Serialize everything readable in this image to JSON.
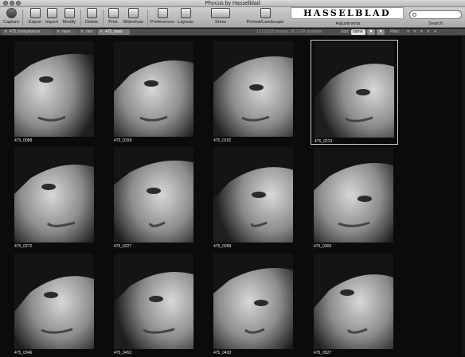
{
  "window": {
    "title": "Phocus by Hasselblad"
  },
  "toolbar": {
    "capture": "Capture",
    "export": "Export",
    "import": "Import",
    "modify": "Modify",
    "delete": "Delete",
    "print": "Print",
    "slideshow": "Slideshow",
    "preferences": "Preferences",
    "layouts": "Layouts",
    "show": "Show",
    "portrait_landscape": "Portrait/Landscape",
    "brand": "HASSELBLAD",
    "adjustments": "Adjustments",
    "search_label": "Search",
    "search_value": ""
  },
  "tabs": [
    {
      "label": "475_kompetanse"
    },
    {
      "label": "raws"
    },
    {
      "label": "raw"
    },
    {
      "label": "475_raws"
    }
  ],
  "statusbar": {
    "info": "12 (13/28) images, 85.1 GB available",
    "sort_label": "Sort:",
    "sort_value": "name",
    "filter_label": "Filter:",
    "filter_stars": "★ ★ ★ ★ ★"
  },
  "thumbnails": [
    {
      "name": "475_0088"
    },
    {
      "name": "475_0158"
    },
    {
      "name": "475_0192"
    },
    {
      "name": "475_0219"
    },
    {
      "name": "475_0272"
    },
    {
      "name": "475_0227"
    },
    {
      "name": "475_0288"
    },
    {
      "name": "475_0306"
    },
    {
      "name": "475_0346"
    },
    {
      "name": "475_0452"
    },
    {
      "name": "475_0493"
    },
    {
      "name": "475_0527"
    }
  ],
  "selected_index": 3,
  "colors": {
    "background": "#0b0b0b",
    "toolbar": "#bdbdbd",
    "tabbar": "#4d4d4d"
  },
  "icons": {
    "capture": "camera-icon",
    "export": "export-icon",
    "import": "import-icon",
    "modify": "sliders-icon",
    "delete": "trash-icon",
    "print": "printer-icon",
    "slideshow": "slideshow-icon",
    "preferences": "preferences-icon",
    "layouts": "layouts-icon",
    "portrait_landscape": "rotate-icon"
  }
}
